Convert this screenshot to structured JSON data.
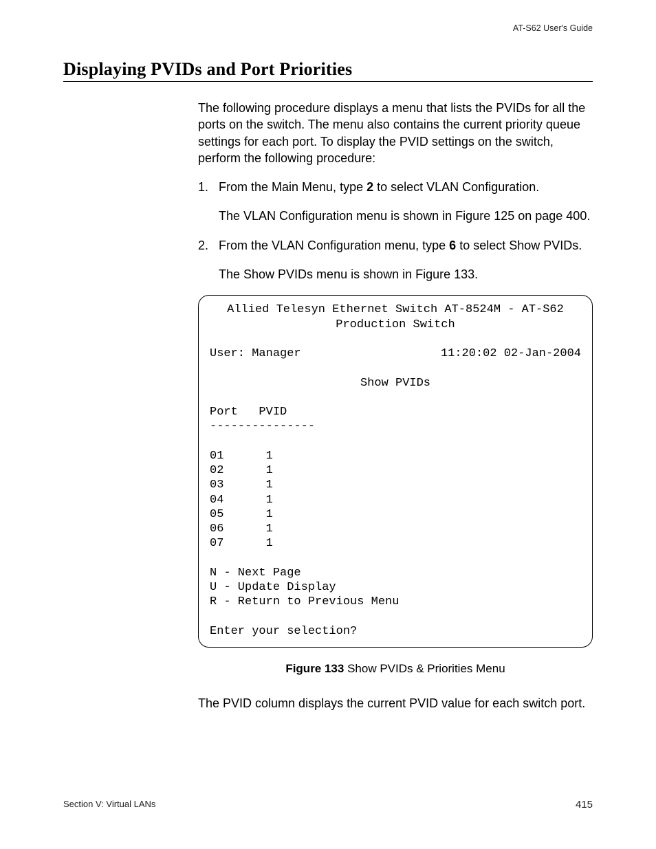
{
  "running_head": "AT-S62 User's Guide",
  "section_title": "Displaying PVIDs and Port Priorities",
  "intro_paragraph": "The following procedure displays a menu that lists the PVIDs for all the ports on the switch. The menu also contains the current priority queue settings for each port. To display the PVID settings on the switch, perform the following procedure:",
  "steps": [
    {
      "lead_a": "From the Main Menu, type ",
      "bold": "2",
      "lead_b": " to select VLAN Configuration.",
      "after": "The VLAN Configuration menu is shown in Figure 125 on page 400."
    },
    {
      "lead_a": "From the VLAN Configuration menu, type ",
      "bold": "6",
      "lead_b": " to select Show PVIDs.",
      "after": "The Show PVIDs menu is shown in Figure 133."
    }
  ],
  "terminal": {
    "title_line1": "Allied Telesyn Ethernet Switch AT-8524M - AT-S62",
    "title_line2": "Production Switch",
    "user_label": "User: Manager",
    "timestamp": "11:20:02 02-Jan-2004",
    "screen_name": "Show PVIDs",
    "col_header": "Port   PVID",
    "divider": "---------------",
    "rows": [
      "01      1",
      "02      1",
      "03      1",
      "04      1",
      "05      1",
      "06      1",
      "07      1"
    ],
    "opt_next": "N - Next Page",
    "opt_update": "U - Update Display",
    "opt_return": "R - Return to Previous Menu",
    "prompt": "Enter your selection?"
  },
  "figure_caption_label": "Figure 133",
  "figure_caption_text": "  Show PVIDs & Priorities Menu",
  "closing_paragraph": "The PVID column displays the current PVID value for each switch port.",
  "footer_left": "Section V: Virtual LANs",
  "footer_right": "415"
}
